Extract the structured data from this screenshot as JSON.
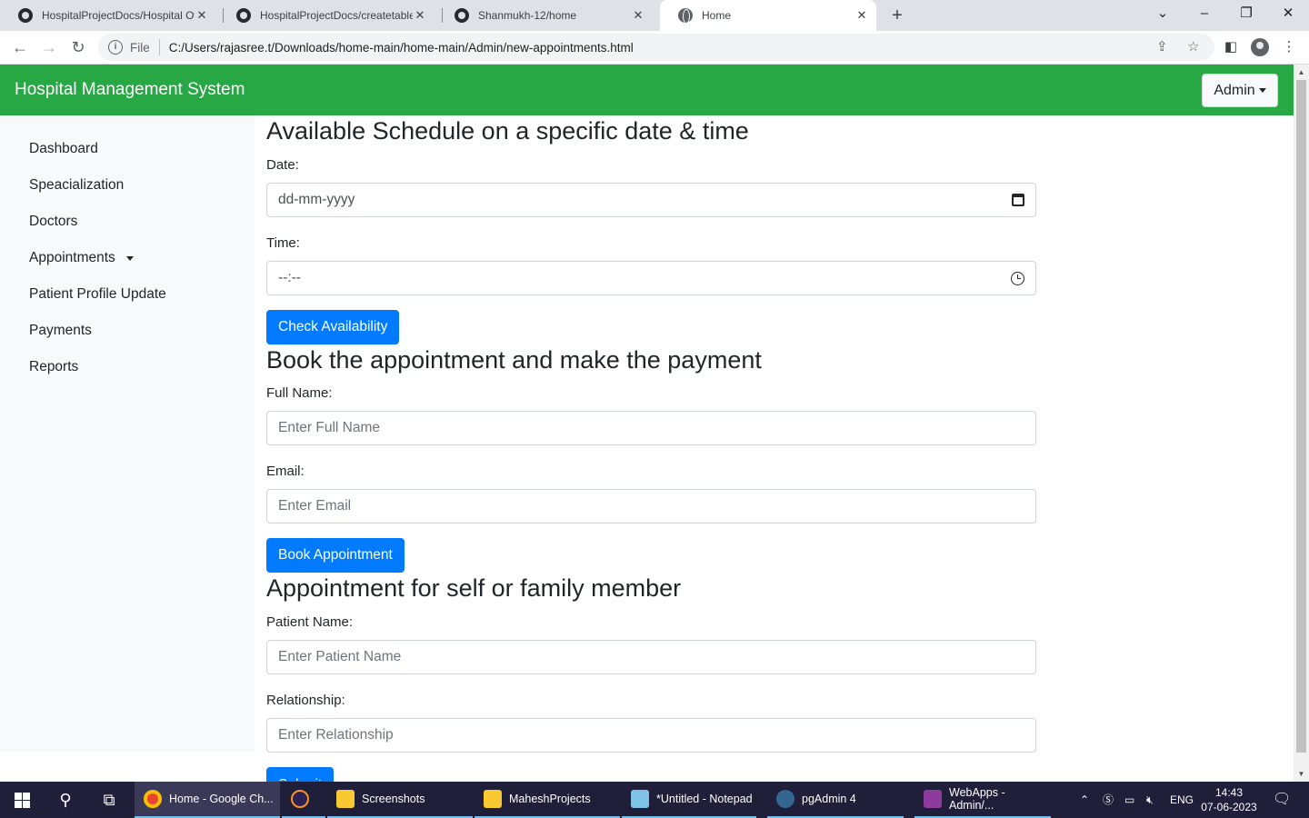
{
  "browser": {
    "tabs": [
      {
        "title": "HospitalProjectDocs/Hospital Ov",
        "icon": "github-icon"
      },
      {
        "title": "HospitalProjectDocs/createtables",
        "icon": "github-icon"
      },
      {
        "title": "Shanmukh-12/home",
        "icon": "github-icon"
      },
      {
        "title": "Home",
        "icon": "globe-icon"
      }
    ],
    "file_label": "File",
    "url": "C:/Users/rajasree.t/Downloads/home-main/home-main/Admin/new-appointments.html"
  },
  "navbar": {
    "brand": "Hospital Management System",
    "admin_label": "Admin",
    "color": "#28a745"
  },
  "sidebar": {
    "items": [
      {
        "label": "Dashboard"
      },
      {
        "label": "Speacialization"
      },
      {
        "label": "Doctors"
      },
      {
        "label": "Appointments"
      },
      {
        "label": "Patient Profile Update"
      },
      {
        "label": "Payments"
      },
      {
        "label": "Reports"
      }
    ]
  },
  "schedule": {
    "heading": "Available Schedule on a specific date & time",
    "date_label": "Date:",
    "date_value": "dd-mm-yyyy",
    "time_label": "Time:",
    "time_value": "--:--",
    "button": "Check Availability"
  },
  "booking": {
    "heading": "Book the appointment and make the payment",
    "name_label": "Full Name:",
    "name_placeholder": "Enter Full Name",
    "email_label": "Email:",
    "email_placeholder": "Enter Email",
    "button": "Book Appointment"
  },
  "family": {
    "heading": "Appointment for self or family member",
    "patient_label": "Patient Name:",
    "patient_placeholder": "Enter Patient Name",
    "relationship_label": "Relationship:",
    "relationship_placeholder": "Enter Relationship",
    "submit": "Submit"
  },
  "taskbar": {
    "apps": [
      {
        "label": "Home - Google Ch...",
        "icon": "chrome-icon"
      },
      {
        "label": "",
        "icon": "eclipse-icon"
      },
      {
        "label": "Screenshots",
        "icon": "folder-icon"
      },
      {
        "label": "MaheshProjects",
        "icon": "folder-icon"
      },
      {
        "label": "*Untitled - Notepad",
        "icon": "notepad-icon"
      },
      {
        "label": "pgAdmin 4",
        "icon": "pgadmin-icon"
      },
      {
        "label": "WebApps - Admin/...",
        "icon": "app-icon"
      }
    ],
    "lang": "ENG",
    "time": "14:43",
    "date": "07-06-2023"
  },
  "colors": {
    "primary_button": "#007bff",
    "sidebar_bg": "#f8f9fa"
  }
}
